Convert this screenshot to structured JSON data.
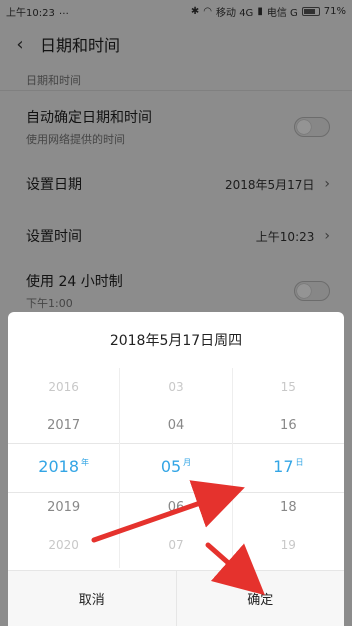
{
  "status_bar": {
    "time": "上午10:23",
    "carrier1": "移动 4G",
    "carrier2": "电信 G",
    "battery": "71%"
  },
  "header": {
    "title": "日期和时间"
  },
  "settings": {
    "section_label": "日期和时间",
    "auto": {
      "title": "自动确定日期和时间",
      "subtitle": "使用网络提供的时间"
    },
    "set_date": {
      "title": "设置日期",
      "value": "2018年5月17日"
    },
    "set_time": {
      "title": "设置时间",
      "value": "上午10:23"
    },
    "use24": {
      "title": "使用 24 小时制",
      "subtitle": "下午1:00"
    }
  },
  "dialog": {
    "title": "2018年5月17日周四",
    "year": {
      "items": [
        "2016",
        "2017",
        "2018",
        "2019",
        "2020"
      ],
      "unit": "年"
    },
    "month": {
      "items": [
        "03",
        "04",
        "05",
        "06",
        "07"
      ],
      "unit": "月"
    },
    "day": {
      "items": [
        "15",
        "16",
        "17",
        "18",
        "19"
      ],
      "unit": "日"
    },
    "cancel_label": "取消",
    "confirm_label": "确定"
  },
  "colors": {
    "accent": "#33a5e5",
    "arrow": "#e5322d"
  }
}
